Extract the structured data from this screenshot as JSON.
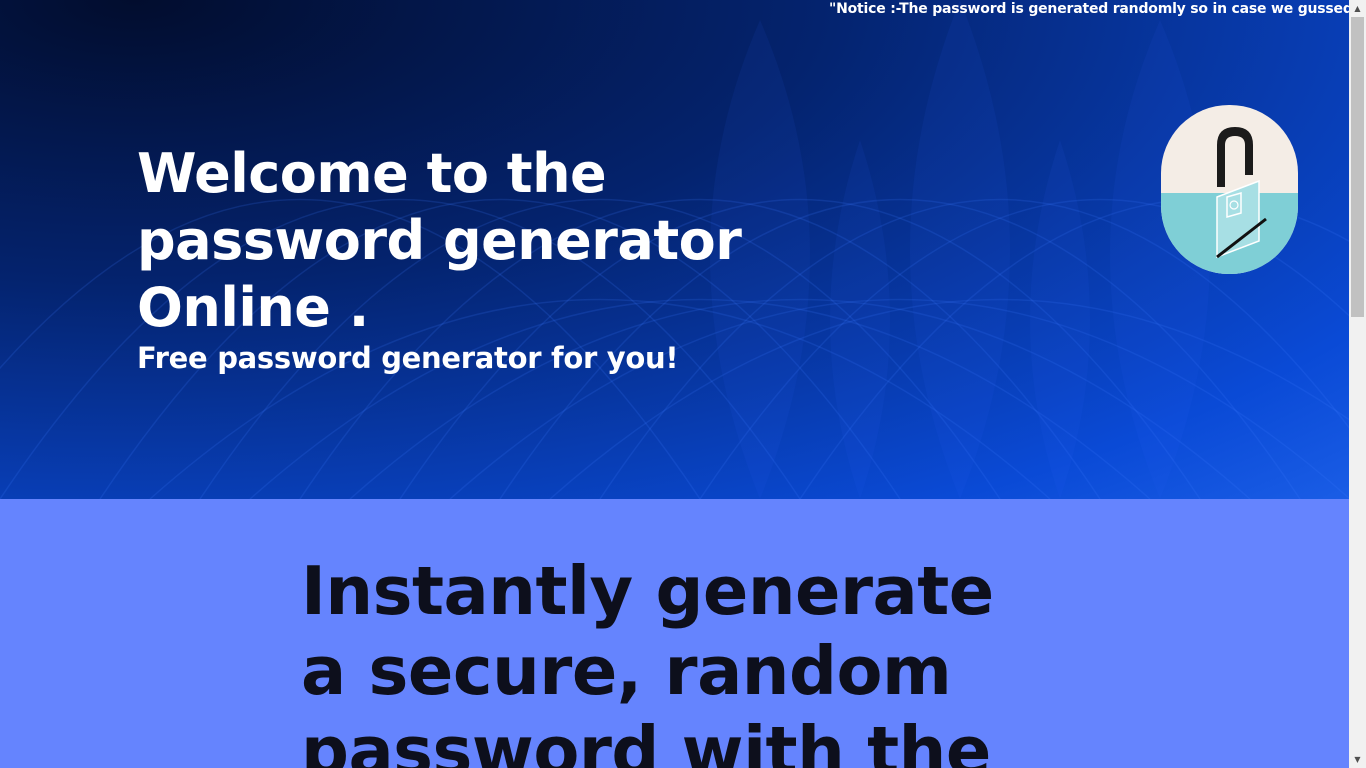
{
  "notice": {
    "text": "\"Notice :-The password is generated randomly so in case we gussed a"
  },
  "hero": {
    "title": "Welcome to the password generator Online .",
    "subtitle": "Free password generator for you!",
    "lock_icon": "padlock-icon"
  },
  "section2": {
    "title": "Instantly generate a secure, random password with the"
  },
  "colors": {
    "hero_dark": "#020d2e",
    "hero_blue": "#0a4ad6",
    "section_bg": "#6584fe",
    "badge_cream": "#f4ede6",
    "badge_teal": "#7fcfd6"
  }
}
